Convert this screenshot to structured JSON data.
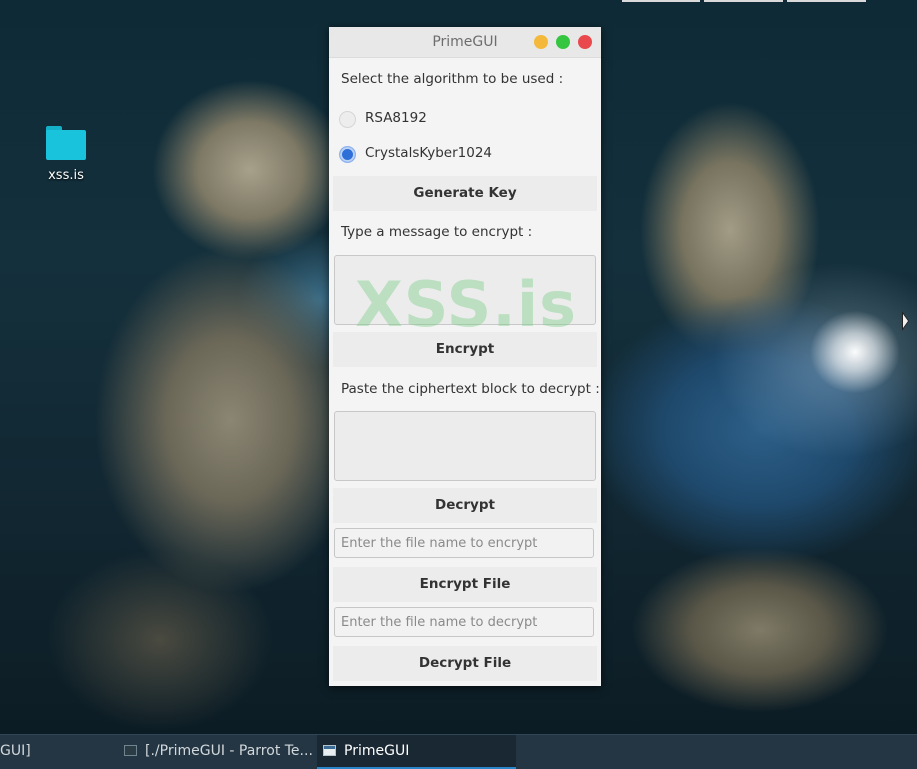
{
  "desktop": {
    "icon_label": "xss.is"
  },
  "window": {
    "title": "PrimeGUI",
    "algorithm_prompt": "Select the algorithm to be used :",
    "algorithms": [
      {
        "label": "RSA8192",
        "checked": false
      },
      {
        "label": "CrystalsKyber1024",
        "checked": true
      }
    ],
    "generate_key_label": "Generate Key",
    "encrypt_prompt": "Type a message to encrypt :",
    "encrypt_label": "Encrypt",
    "decrypt_prompt": "Paste the ciphertext block to decrypt :",
    "decrypt_label": "Decrypt",
    "encrypt_file_placeholder": "Enter the file name to encrypt",
    "encrypt_file_label": "Encrypt File",
    "decrypt_file_placeholder": "Enter the file name to decrypt",
    "decrypt_file_label": "Decrypt File",
    "watermark": "XSS.is"
  },
  "taskbar": {
    "items": [
      {
        "label": "GUI]"
      },
      {
        "label": "[./PrimeGUI - Parrot Te..."
      },
      {
        "label": "PrimeGUI"
      }
    ]
  },
  "colors": {
    "accent": "#2a86c8",
    "radio_checked": "#2f6fd8",
    "folder": "#19c3dc",
    "taskbar": "#243643"
  }
}
